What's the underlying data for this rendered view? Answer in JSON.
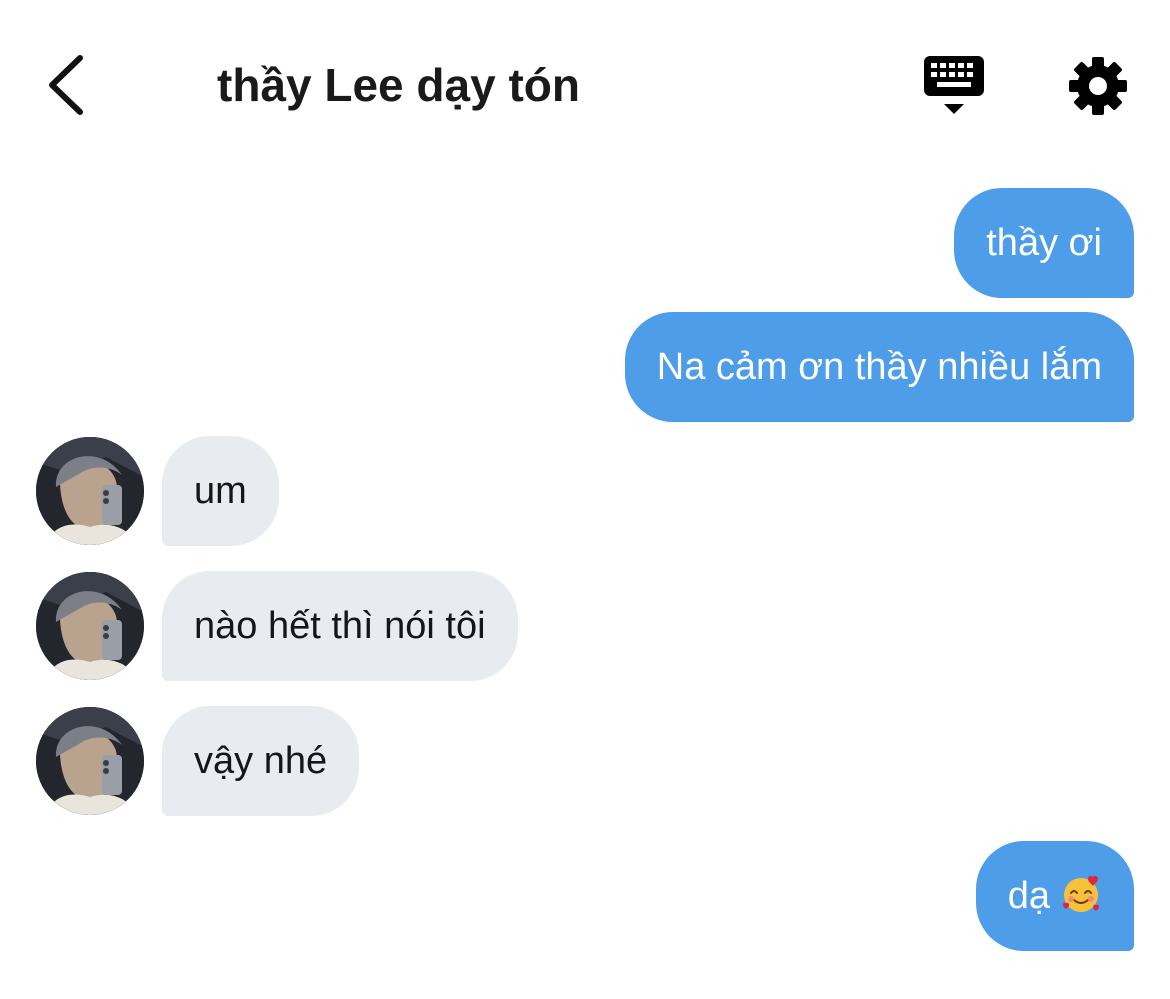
{
  "header": {
    "title": "thầy Lee dạy tón"
  },
  "messages": [
    {
      "direction": "outgoing",
      "text": "thầy ơi"
    },
    {
      "direction": "outgoing",
      "text": "Na cảm ơn thầy nhiều lắm"
    },
    {
      "direction": "incoming",
      "text": "um"
    },
    {
      "direction": "incoming",
      "text": "nào hết thì nói tôi"
    },
    {
      "direction": "incoming",
      "text": "vậy nhé"
    },
    {
      "direction": "outgoing",
      "text": "dạ",
      "emoji": "smiling-face-with-hearts"
    }
  ],
  "icons": {
    "back": "chevron-left-icon",
    "keyboard": "keyboard-icon",
    "settings": "gear-icon"
  },
  "colors": {
    "outgoing_bubble": "#4d9de9",
    "incoming_bubble": "#e8ebef",
    "title_text": "#1a1a1a"
  }
}
